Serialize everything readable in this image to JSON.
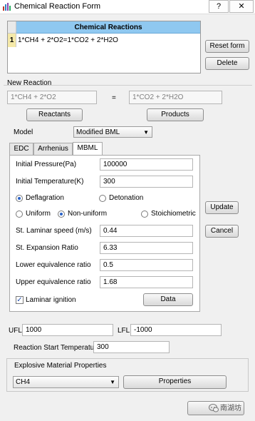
{
  "window": {
    "title": "Chemical Reaction Form",
    "help_label": "?",
    "close_label": "✕"
  },
  "reactions_table": {
    "header": "Chemical Reactions",
    "rows": [
      {
        "index": "1",
        "equation": "1*CH4 + 2*O2=1*CO2 + 2*H2O"
      }
    ]
  },
  "side_buttons": {
    "reset": "Reset form",
    "delete": "Delete",
    "update": "Update",
    "cancel": "Cancel"
  },
  "new_reaction": {
    "group_label": "New Reaction",
    "reactants_value": "1*CH4 + 2*O2",
    "equals": "=",
    "products_value": "1*CO2 + 2*H2O",
    "reactants_button": "Reactants",
    "products_button": "Products",
    "model_label": "Model",
    "model_value": "Modified BML"
  },
  "tabs": [
    "EDC",
    "Arrhenius",
    "MBML"
  ],
  "mbml": {
    "initial_pressure_label": "Initial Pressure(Pa)",
    "initial_pressure_value": "100000",
    "initial_temperature_label": "Initial Temperature(K)",
    "initial_temperature_value": "300",
    "deflagration_label": "Deflagration",
    "detonation_label": "Detonation",
    "uniform_label": "Uniform",
    "non_uniform_label": "Non-uniform",
    "stoichiometric_label": "Stoichiometric",
    "laminar_speed_label": "St. Laminar speed (m/s)",
    "laminar_speed_value": "0.44",
    "expansion_ratio_label": "St. Expansion Ratio",
    "expansion_ratio_value": "6.33",
    "lower_equiv_label": "Lower equivalence ratio",
    "lower_equiv_value": "0.5",
    "upper_equiv_label": "Upper equivalence ratio",
    "upper_equiv_value": "1.68",
    "laminar_ignition_label": "Laminar ignition",
    "data_button": "Data"
  },
  "limits": {
    "ufl_label": "UFL",
    "ufl_value": "1000",
    "lfl_label": "LFL",
    "lfl_value": "-1000"
  },
  "start_temp": {
    "label": "Reaction Start Temperature",
    "value": "300"
  },
  "explosive": {
    "group_label": "Explosive Material Properties",
    "material": "CH4",
    "properties_button": "Properties"
  },
  "watermark": "南湖坊",
  "colors": {
    "header_blue": "#8fc8f0",
    "row_highlight": "#f5e9a8"
  }
}
